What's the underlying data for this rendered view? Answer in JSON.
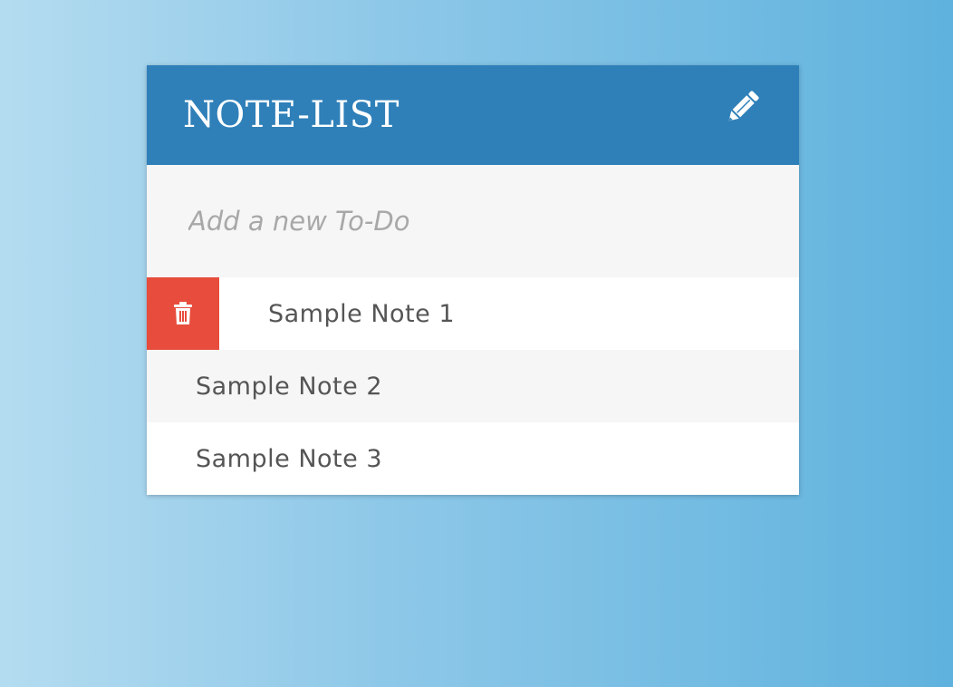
{
  "header": {
    "title": "NOTE-LIST",
    "icon": "pencil-icon"
  },
  "input": {
    "placeholder": "Add a new To-Do",
    "value": ""
  },
  "notes": [
    {
      "label": "Sample Note 1",
      "delete_icon": "trash-icon",
      "show_delete": true
    },
    {
      "label": "Sample Note 2"
    },
    {
      "label": "Sample Note 3"
    }
  ],
  "colors": {
    "header": "#2f80b9",
    "delete": "#e74c3c",
    "row_alt": "#f6f6f6",
    "text": "#555555"
  }
}
